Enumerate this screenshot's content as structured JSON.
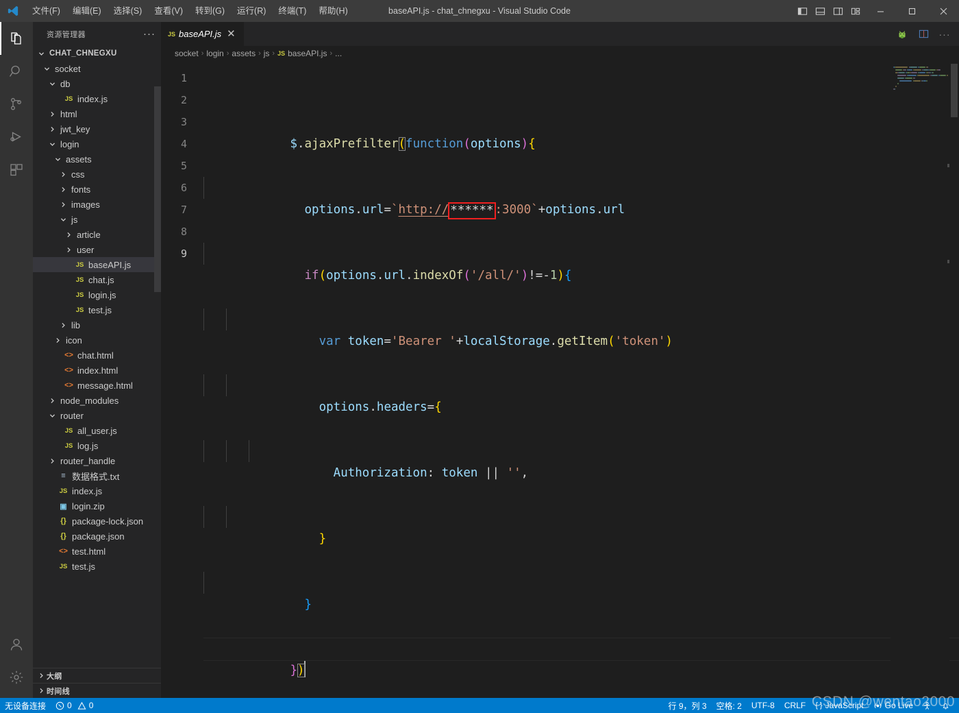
{
  "window": {
    "title": "baseAPI.js - chat_chnegxu - Visual Studio Code",
    "logo_icon": "vscode-logo-icon",
    "menus": [
      {
        "label": "文件(F)",
        "name": "menu-file"
      },
      {
        "label": "编辑(E)",
        "name": "menu-edit"
      },
      {
        "label": "选择(S)",
        "name": "menu-selection"
      },
      {
        "label": "查看(V)",
        "name": "menu-view"
      },
      {
        "label": "转到(G)",
        "name": "menu-go"
      },
      {
        "label": "运行(R)",
        "name": "menu-run"
      },
      {
        "label": "终端(T)",
        "name": "menu-terminal"
      },
      {
        "label": "帮助(H)",
        "name": "menu-help"
      }
    ],
    "layout_buttons": [
      {
        "name": "toggle-primary-sidebar-icon"
      },
      {
        "name": "toggle-panel-icon"
      },
      {
        "name": "toggle-secondary-sidebar-icon"
      },
      {
        "name": "customize-layout-icon"
      }
    ],
    "window_controls": [
      {
        "name": "minimize-button",
        "glyph": "─"
      },
      {
        "name": "maximize-button",
        "glyph": "□"
      },
      {
        "name": "close-button",
        "glyph": "✕"
      }
    ]
  },
  "activitybar": {
    "items": [
      {
        "name": "activity-explorer",
        "icon": "files-icon",
        "active": true
      },
      {
        "name": "activity-search",
        "icon": "search-icon",
        "active": false
      },
      {
        "name": "activity-source-control",
        "icon": "source-control-icon",
        "active": false
      },
      {
        "name": "activity-run-debug",
        "icon": "run-and-debug-icon",
        "active": false
      },
      {
        "name": "activity-extensions",
        "icon": "extensions-icon",
        "active": false
      }
    ],
    "bottom": [
      {
        "name": "activity-accounts",
        "icon": "account-icon"
      },
      {
        "name": "activity-settings",
        "icon": "gear-icon"
      }
    ]
  },
  "sidebar": {
    "header_title": "资源管理器",
    "header_actions_icon": "more-actions-icon",
    "tree": [
      {
        "label": "CHAT_CHNEGXU",
        "indent": 0,
        "kind": "root",
        "twisty": "down",
        "icon": ""
      },
      {
        "label": "socket",
        "indent": 1,
        "kind": "folder",
        "twisty": "down",
        "icon": ""
      },
      {
        "label": "db",
        "indent": 2,
        "kind": "folder",
        "twisty": "down",
        "icon": ""
      },
      {
        "label": "index.js",
        "indent": 3,
        "kind": "file",
        "twisty": "",
        "icon": "js"
      },
      {
        "label": "html",
        "indent": 2,
        "kind": "folder",
        "twisty": "right",
        "icon": ""
      },
      {
        "label": "jwt_key",
        "indent": 2,
        "kind": "folder",
        "twisty": "right",
        "icon": ""
      },
      {
        "label": "login",
        "indent": 2,
        "kind": "folder",
        "twisty": "down",
        "icon": ""
      },
      {
        "label": "assets",
        "indent": 3,
        "kind": "folder",
        "twisty": "down",
        "icon": ""
      },
      {
        "label": "css",
        "indent": 4,
        "kind": "folder",
        "twisty": "right",
        "icon": ""
      },
      {
        "label": "fonts",
        "indent": 4,
        "kind": "folder",
        "twisty": "right",
        "icon": ""
      },
      {
        "label": "images",
        "indent": 4,
        "kind": "folder",
        "twisty": "right",
        "icon": ""
      },
      {
        "label": "js",
        "indent": 4,
        "kind": "folder",
        "twisty": "down",
        "icon": ""
      },
      {
        "label": "article",
        "indent": 5,
        "kind": "folder",
        "twisty": "right",
        "icon": ""
      },
      {
        "label": "user",
        "indent": 5,
        "kind": "folder",
        "twisty": "right",
        "icon": ""
      },
      {
        "label": "baseAPI.js",
        "indent": 5,
        "kind": "file",
        "twisty": "",
        "icon": "js",
        "selected": true
      },
      {
        "label": "chat.js",
        "indent": 5,
        "kind": "file",
        "twisty": "",
        "icon": "js"
      },
      {
        "label": "login.js",
        "indent": 5,
        "kind": "file",
        "twisty": "",
        "icon": "js"
      },
      {
        "label": "test.js",
        "indent": 5,
        "kind": "file",
        "twisty": "",
        "icon": "js"
      },
      {
        "label": "lib",
        "indent": 4,
        "kind": "folder",
        "twisty": "right",
        "icon": ""
      },
      {
        "label": "icon",
        "indent": 3,
        "kind": "folder",
        "twisty": "right",
        "icon": ""
      },
      {
        "label": "chat.html",
        "indent": 3,
        "kind": "file",
        "twisty": "",
        "icon": "html"
      },
      {
        "label": "index.html",
        "indent": 3,
        "kind": "file",
        "twisty": "",
        "icon": "html"
      },
      {
        "label": "message.html",
        "indent": 3,
        "kind": "file",
        "twisty": "",
        "icon": "html"
      },
      {
        "label": "node_modules",
        "indent": 2,
        "kind": "folder",
        "twisty": "right",
        "icon": ""
      },
      {
        "label": "router",
        "indent": 2,
        "kind": "folder",
        "twisty": "down",
        "icon": ""
      },
      {
        "label": "all_user.js",
        "indent": 3,
        "kind": "file",
        "twisty": "",
        "icon": "js"
      },
      {
        "label": "log.js",
        "indent": 3,
        "kind": "file",
        "twisty": "",
        "icon": "js"
      },
      {
        "label": "router_handle",
        "indent": 2,
        "kind": "folder",
        "twisty": "right",
        "icon": ""
      },
      {
        "label": "数据格式.txt",
        "indent": 2,
        "kind": "file",
        "twisty": "",
        "icon": "txt"
      },
      {
        "label": "index.js",
        "indent": 2,
        "kind": "file",
        "twisty": "",
        "icon": "js"
      },
      {
        "label": "login.zip",
        "indent": 2,
        "kind": "file",
        "twisty": "",
        "icon": "zip"
      },
      {
        "label": "package-lock.json",
        "indent": 2,
        "kind": "file",
        "twisty": "",
        "icon": "json"
      },
      {
        "label": "package.json",
        "indent": 2,
        "kind": "file",
        "twisty": "",
        "icon": "json"
      },
      {
        "label": "test.html",
        "indent": 2,
        "kind": "file",
        "twisty": "",
        "icon": "html"
      },
      {
        "label": "test.js",
        "indent": 2,
        "kind": "file",
        "twisty": "",
        "icon": "js"
      }
    ],
    "sections": [
      {
        "label": "大纲",
        "name": "sidebar-section-outline"
      },
      {
        "label": "时间线",
        "name": "sidebar-section-timeline"
      }
    ]
  },
  "editor": {
    "tab": {
      "label": "baseAPI.js",
      "icon": "js-file-icon",
      "close_glyph": "✕",
      "preview": true
    },
    "tab_actions": [
      {
        "name": "android-run-icon"
      },
      {
        "name": "split-editor-right-icon"
      },
      {
        "name": "more-editor-actions-icon",
        "glyph": "···"
      }
    ],
    "breadcrumb": [
      "socket",
      "login",
      "assets",
      "js",
      "baseAPI.js",
      "..."
    ],
    "breadcrumb_file_icon": "js-file-icon",
    "line_numbers": [
      1,
      2,
      3,
      4,
      5,
      6,
      7,
      8,
      9
    ],
    "active_line": 9,
    "code_lines": [
      "$.ajaxPrefilter(function(options){",
      "  options.url=`http://******:3000`+options.url",
      "  if(options.url.indexOf('/all/')!=-1){",
      "    var token='Bearer '+localStorage.getItem('token')",
      "    options.headers={",
      "      Authorization: token || '',",
      "    }",
      "  }",
      "})"
    ],
    "annotation": {
      "name": "redacted-host-highlight",
      "text": "******",
      "color": "#f02020"
    }
  },
  "statusbar": {
    "left": [
      {
        "name": "remote-status",
        "label": "无设备连接"
      },
      {
        "name": "problems-status",
        "label": "0",
        "label2": "0",
        "error_icon": "error-circle-icon",
        "warning_icon": "warning-triangle-icon"
      }
    ],
    "right": [
      {
        "name": "cursor-position-status",
        "label": "行 9，列 3"
      },
      {
        "name": "indentation-status",
        "label": "空格: 2"
      },
      {
        "name": "encoding-status",
        "label": "UTF-8"
      },
      {
        "name": "eol-status",
        "label": "CRLF"
      },
      {
        "name": "language-mode-status",
        "label": "JavaScript",
        "icon": "json-braces-icon"
      },
      {
        "name": "go-live-status",
        "label": "Go Live",
        "icon": "broadcast-icon"
      },
      {
        "name": "accessibility-status",
        "icon": "person-icon"
      },
      {
        "name": "notifications-status",
        "icon": "bell-icon"
      }
    ]
  },
  "watermark": {
    "text": "CSDN @wentao2000"
  }
}
